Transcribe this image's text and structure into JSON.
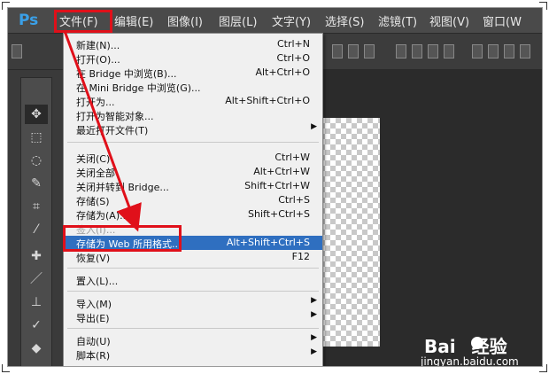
{
  "app": {
    "logo": "Ps"
  },
  "menubar": {
    "items": [
      {
        "label": "文件(F)"
      },
      {
        "label": "编辑(E)"
      },
      {
        "label": "图像(I)"
      },
      {
        "label": "图层(L)"
      },
      {
        "label": "文字(Y)"
      },
      {
        "label": "选择(S)"
      },
      {
        "label": "滤镜(T)"
      },
      {
        "label": "视图(V)"
      },
      {
        "label": "窗口(W"
      }
    ]
  },
  "file_menu": {
    "items": [
      {
        "label": "新建(N)...",
        "shortcut": "Ctrl+N"
      },
      {
        "label": "打开(O)...",
        "shortcut": "Ctrl+O"
      },
      {
        "label": "在 Bridge 中浏览(B)...",
        "shortcut": "Alt+Ctrl+O"
      },
      {
        "label": "在 Mini Bridge 中浏览(G)...",
        "shortcut": ""
      },
      {
        "label": "打开为...",
        "shortcut": "Alt+Shift+Ctrl+O"
      },
      {
        "label": "打开为智能对象...",
        "shortcut": ""
      },
      {
        "label": "最近打开文件(T)",
        "shortcut": ""
      },
      {
        "label": "关闭(C)",
        "shortcut": "Ctrl+W"
      },
      {
        "label": "关闭全部",
        "shortcut": "Alt+Ctrl+W"
      },
      {
        "label": "关闭并转到 Bridge...",
        "shortcut": "Shift+Ctrl+W"
      },
      {
        "label": "存储(S)",
        "shortcut": "Ctrl+S"
      },
      {
        "label": "存储为(A)...",
        "shortcut": "Shift+Ctrl+S"
      },
      {
        "label": "签入(I)...",
        "shortcut": ""
      },
      {
        "label": "存储为 Web 所用格式...",
        "shortcut": "Alt+Shift+Ctrl+S"
      },
      {
        "label": "恢复(V)",
        "shortcut": "F12"
      },
      {
        "label": "置入(L)...",
        "shortcut": ""
      },
      {
        "label": "导入(M)",
        "shortcut": ""
      },
      {
        "label": "导出(E)",
        "shortcut": ""
      },
      {
        "label": "自动(U)",
        "shortcut": ""
      },
      {
        "label": "脚本(R)",
        "shortcut": ""
      }
    ]
  },
  "watermark": {
    "brand": "Bai",
    "brand2": "经验",
    "url": "jingyan.baidu.com"
  },
  "colors": {
    "highlight": "#2f6fc0",
    "annotation": "#e0101a"
  }
}
